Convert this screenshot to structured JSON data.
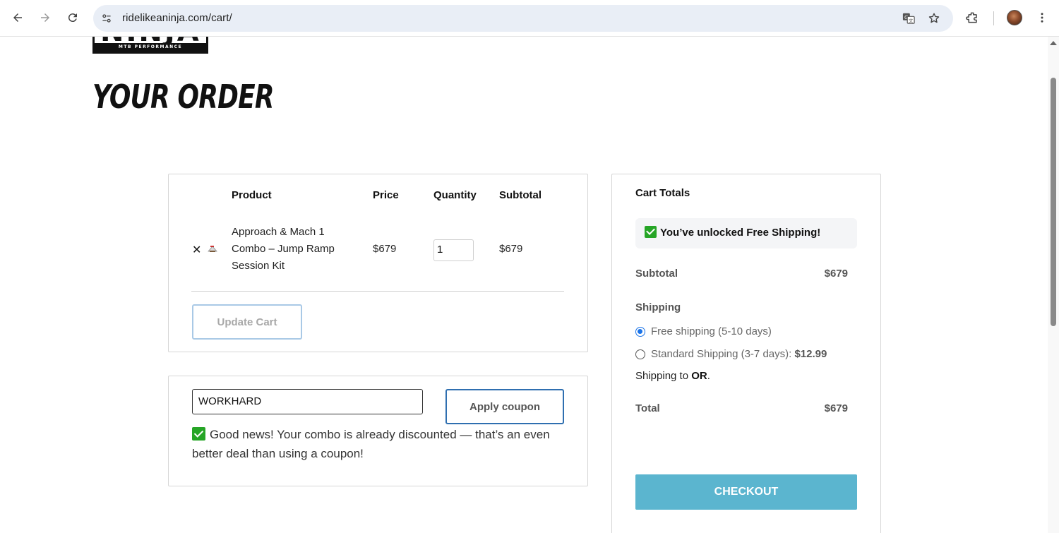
{
  "browser": {
    "url": "ridelikeaninja.com/cart/"
  },
  "logo": {
    "wordmark": "NINJA",
    "tagline": "MTB PERFORMANCE"
  },
  "page": {
    "title": "YOUR ORDER"
  },
  "cart": {
    "headers": {
      "product": "Product",
      "price": "Price",
      "quantity": "Quantity",
      "subtotal": "Subtotal"
    },
    "items": [
      {
        "remove": "✕",
        "name": "Approach & Mach 1 Combo – Jump Ramp Session Kit",
        "price": "$679",
        "quantity": "1",
        "subtotal": "$679"
      }
    ],
    "update_label": "Update Cart"
  },
  "coupon": {
    "code": "WORKHARD",
    "apply_label": "Apply coupon",
    "message": "Good news! Your combo is already discounted — that’s an even better deal than using a coupon!"
  },
  "totals": {
    "title": "Cart Totals",
    "free_shipping_notice": "You’ve unlocked Free Shipping!",
    "subtotal_label": "Subtotal",
    "subtotal_value": "$679",
    "shipping_label": "Shipping",
    "shipping_options": [
      {
        "label": "Free shipping (5-10 days)",
        "price": "",
        "selected": true
      },
      {
        "label": "Standard Shipping (3-7 days): ",
        "price": "$12.99",
        "selected": false
      }
    ],
    "shipping_to_prefix": "Shipping to ",
    "shipping_to_state": "OR",
    "shipping_to_suffix": ".",
    "total_label": "Total",
    "total_value": "$679",
    "checkout_label": "CHECKOUT"
  },
  "colors": {
    "checkout": "#5bb5cf",
    "apply_border": "#2f6fb0",
    "check_green": "#26a526",
    "radio_selected": "#1a73e8"
  }
}
